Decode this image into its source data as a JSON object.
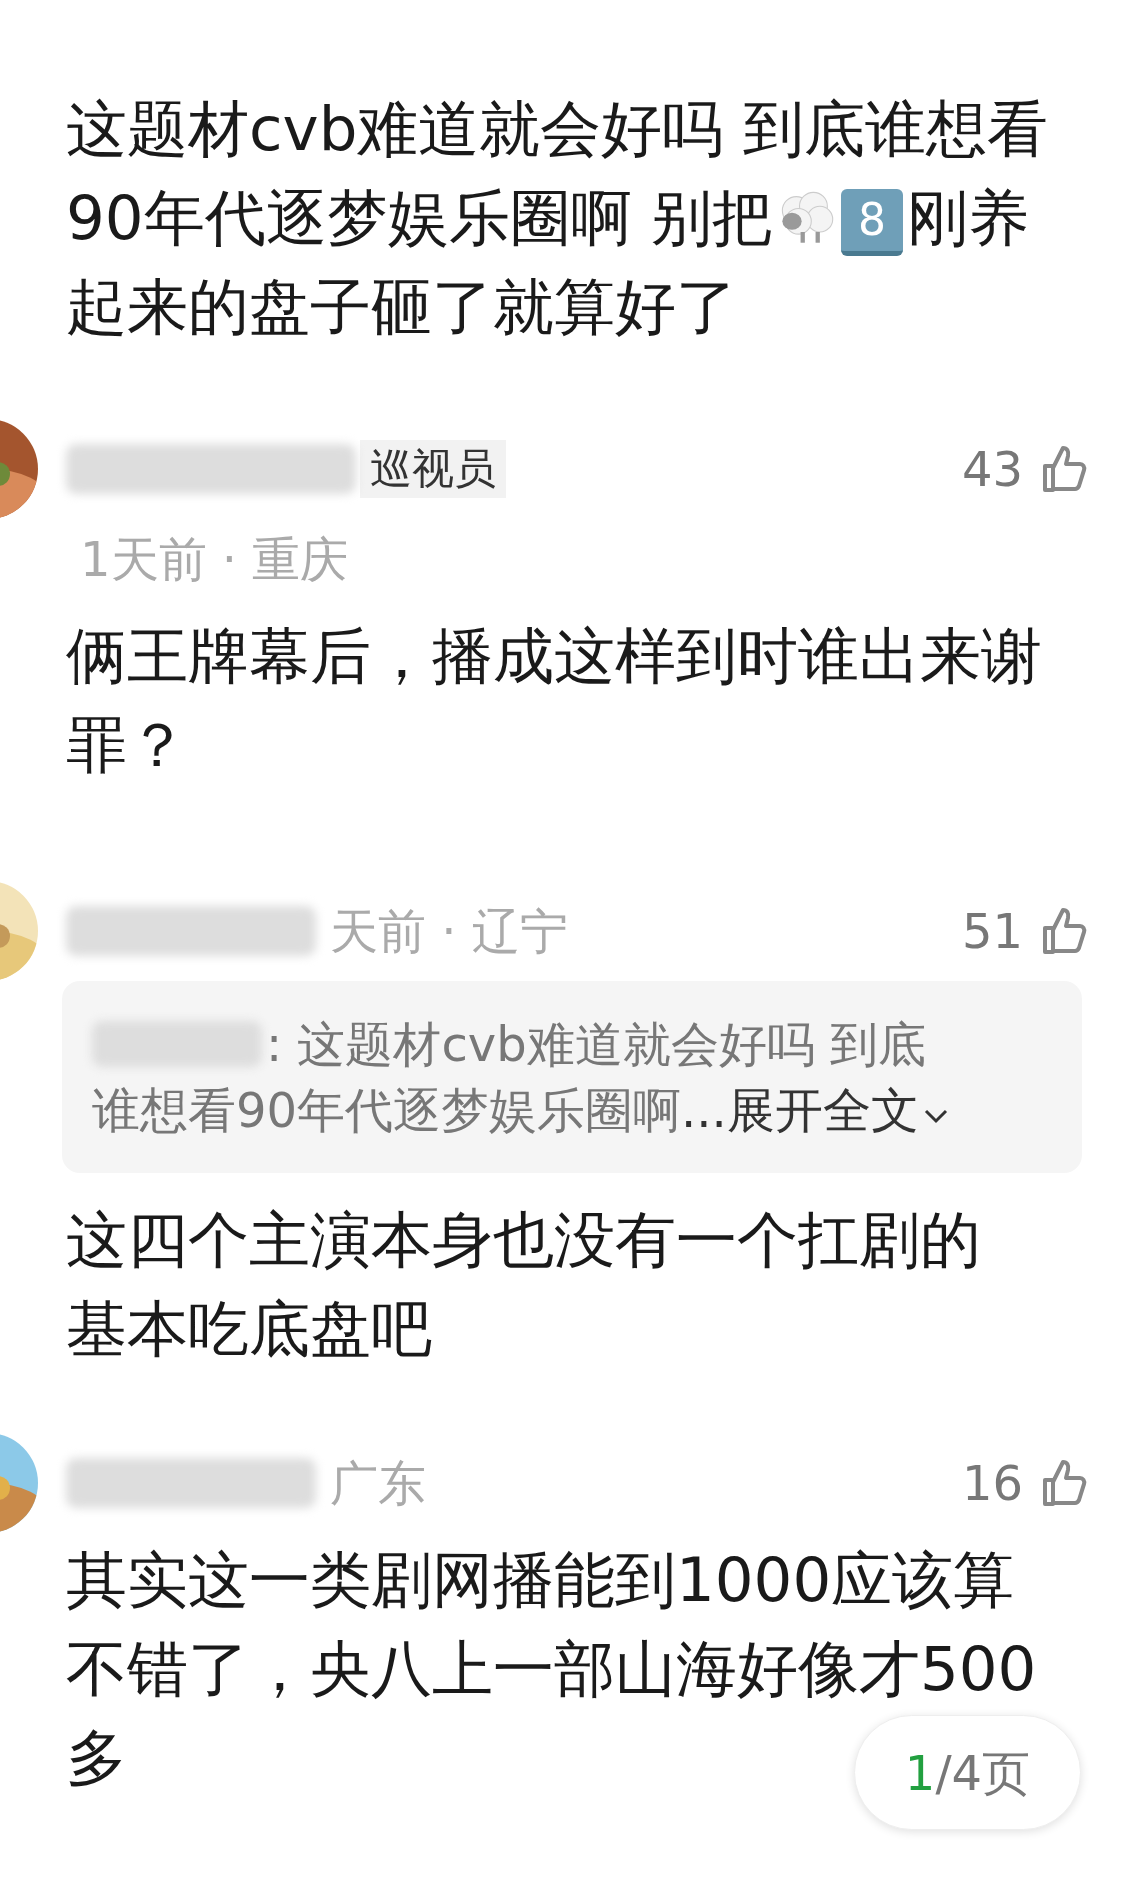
{
  "comments": [
    {
      "kind": "plain",
      "lines": [
        {
          "text": "这题材cvb难道就会好吗 到底谁想看"
        },
        {
          "text": "90年代逐梦娱乐圈啊 别把",
          "keycap": "8",
          "after": "刚养"
        },
        {
          "text": "起来的盘子砸了就算好了"
        }
      ]
    },
    {
      "kind": "full",
      "badge": "巡视员",
      "likes": "43",
      "meta": "1天前 · 重庆",
      "lines": [
        {
          "text": "俩王牌幕后，播成这样到时谁出来谢"
        },
        {
          "text": "罪？"
        }
      ]
    },
    {
      "kind": "full",
      "likes": "51",
      "meta": "天前 · 辽宁",
      "reply": {
        "lines": [
          ": 这题材cvb难道就会好吗 到底",
          "谁想看90年代逐梦娱乐圈啊"
        ],
        "more": " ...展开全文"
      },
      "lines": [
        {
          "text": "这四个主演本身也没有一个扛剧的"
        },
        {
          "text": "基本吃底盘吧"
        }
      ]
    },
    {
      "kind": "full",
      "likes": "16",
      "meta": "广东",
      "lines": [
        {
          "text": "其实这一类剧网播能到1000应该算"
        },
        {
          "text": "不错了，央八上一部山海好像才500"
        },
        {
          "text": "多"
        }
      ]
    }
  ],
  "pager": {
    "current": "1",
    "rest": "/4页"
  }
}
